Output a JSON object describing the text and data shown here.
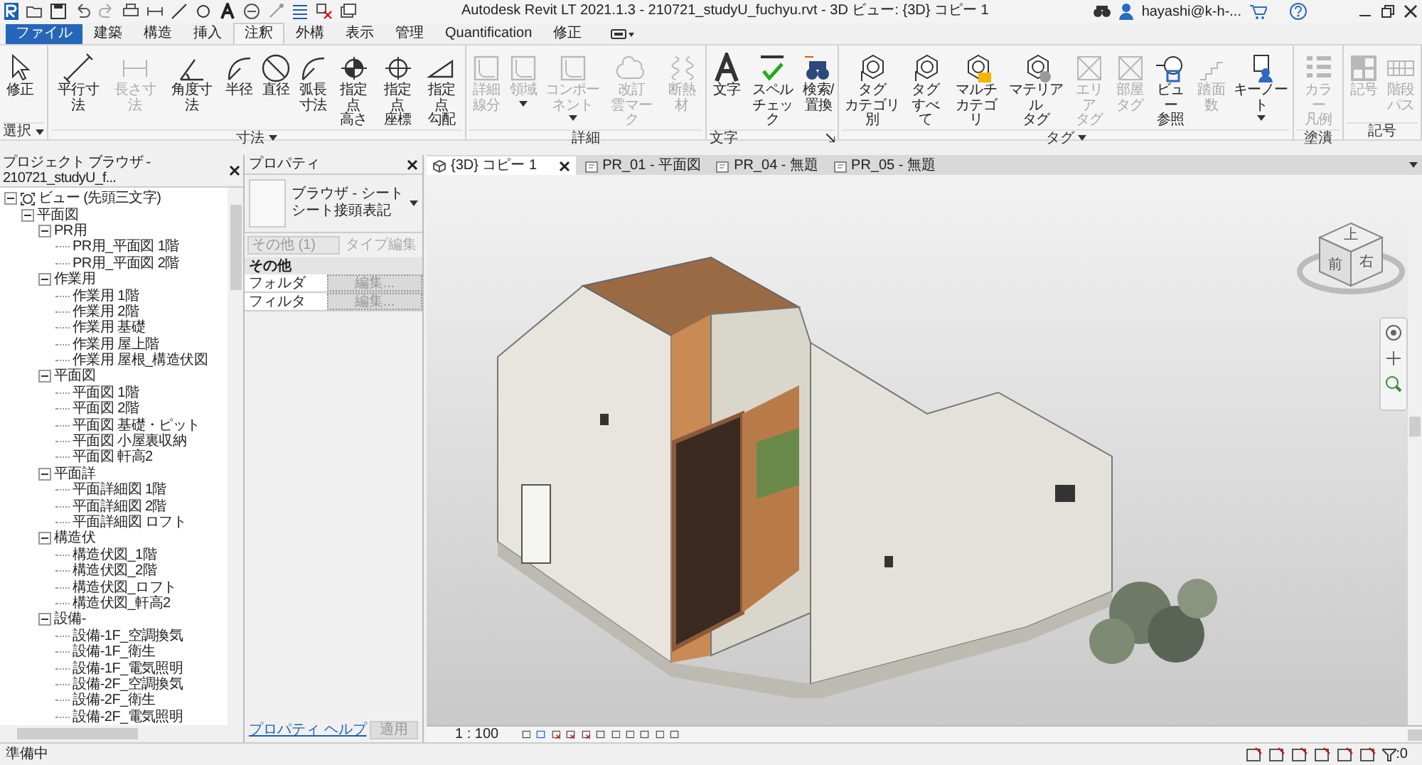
{
  "title_bar": {
    "title": "Autodesk Revit LT 2021.1.3 - 210721_studyU_fuchyu.rvt - 3D ビュー: {3D} コピー 1",
    "user": "hayashi@k-h-..."
  },
  "ribbon_tabs": [
    {
      "label": "ファイル",
      "kind": "file",
      "selected": false
    },
    {
      "label": "建築",
      "kind": "tab",
      "selected": false
    },
    {
      "label": "構造",
      "kind": "tab",
      "selected": false
    },
    {
      "label": "挿入",
      "kind": "tab",
      "selected": false
    },
    {
      "label": "注釈",
      "kind": "tab",
      "selected": true
    },
    {
      "label": "外構",
      "kind": "tab",
      "selected": false
    },
    {
      "label": "表示",
      "kind": "tab",
      "selected": false
    },
    {
      "label": "管理",
      "kind": "tab",
      "selected": false
    },
    {
      "label": "Quantification",
      "kind": "tab",
      "selected": false
    },
    {
      "label": "修正",
      "kind": "tab",
      "selected": false
    }
  ],
  "ribbon_panels": [
    {
      "title": "選択",
      "has_menu": true,
      "launcher": false,
      "tools": [
        {
          "lines": [
            "修正"
          ],
          "disabled": false,
          "dropdown": false
        }
      ]
    },
    {
      "title": "寸法",
      "has_menu": true,
      "launcher": false,
      "tools": [
        {
          "lines": [
            "平行寸法"
          ],
          "disabled": false,
          "dropdown": false
        },
        {
          "lines": [
            "長さ寸法"
          ],
          "disabled": true,
          "dropdown": false
        },
        {
          "lines": [
            "角度寸法"
          ],
          "disabled": false,
          "dropdown": false
        },
        {
          "lines": [
            "半径"
          ],
          "disabled": false,
          "dropdown": false
        },
        {
          "lines": [
            "直径"
          ],
          "disabled": false,
          "dropdown": false
        },
        {
          "lines": [
            "弧長",
            "寸法"
          ],
          "disabled": false,
          "dropdown": false
        },
        {
          "lines": [
            "指定点",
            "高さ"
          ],
          "disabled": false,
          "dropdown": false
        },
        {
          "lines": [
            "指定点",
            "座標"
          ],
          "disabled": false,
          "dropdown": false
        },
        {
          "lines": [
            "指定点",
            "勾配"
          ],
          "disabled": false,
          "dropdown": false
        }
      ]
    },
    {
      "title": "詳細",
      "has_menu": false,
      "launcher": false,
      "tools": [
        {
          "lines": [
            "詳細",
            "線分"
          ],
          "disabled": true,
          "dropdown": false
        },
        {
          "lines": [
            "領域"
          ],
          "disabled": true,
          "dropdown": true
        },
        {
          "lines": [
            "コンポーネント"
          ],
          "disabled": true,
          "dropdown": true
        },
        {
          "lines": [
            "改訂",
            "雲マーク"
          ],
          "disabled": true,
          "dropdown": false
        },
        {
          "lines": [
            "断熱材"
          ],
          "disabled": true,
          "dropdown": false
        }
      ]
    },
    {
      "title": "文字",
      "has_menu": false,
      "launcher": true,
      "tools": [
        {
          "lines": [
            "文字"
          ],
          "disabled": false,
          "dropdown": false
        },
        {
          "lines": [
            "スペル",
            "チェック"
          ],
          "disabled": false,
          "dropdown": false
        },
        {
          "lines": [
            "検索/",
            "置換"
          ],
          "disabled": false,
          "dropdown": false
        }
      ]
    },
    {
      "title": "タグ",
      "has_menu": true,
      "launcher": false,
      "tools": [
        {
          "lines": [
            "タグ",
            "カテゴリ別"
          ],
          "disabled": false,
          "dropdown": false
        },
        {
          "lines": [
            "タグ",
            "すべて"
          ],
          "disabled": false,
          "dropdown": false
        },
        {
          "lines": [
            "マルチ",
            "カテゴリ"
          ],
          "disabled": false,
          "dropdown": false
        },
        {
          "lines": [
            "マテリアル",
            "タグ"
          ],
          "disabled": false,
          "dropdown": false
        },
        {
          "lines": [
            "エリア",
            "タグ"
          ],
          "disabled": true,
          "dropdown": false
        },
        {
          "lines": [
            "部屋",
            "タグ"
          ],
          "disabled": true,
          "dropdown": false
        },
        {
          "lines": [
            "ビュー",
            "参照"
          ],
          "disabled": false,
          "dropdown": false
        },
        {
          "lines": [
            "踏面",
            "数"
          ],
          "disabled": true,
          "dropdown": false
        },
        {
          "lines": [
            "キーノート"
          ],
          "disabled": false,
          "dropdown": true
        }
      ]
    },
    {
      "title": "塗潰",
      "has_menu": false,
      "launcher": false,
      "tools": [
        {
          "lines": [
            "カラー",
            "凡例"
          ],
          "disabled": true,
          "dropdown": false
        }
      ]
    },
    {
      "title": "記号",
      "has_menu": false,
      "launcher": false,
      "tools": [
        {
          "lines": [
            "記号"
          ],
          "disabled": true,
          "dropdown": false
        },
        {
          "lines": [
            "階段",
            "パス"
          ],
          "disabled": true,
          "dropdown": false
        }
      ]
    }
  ],
  "project_browser": {
    "title": "プロジェクト ブラウザ - 210721_studyU_f...",
    "tree": [
      {
        "label": "ビュー (先頭三文字)",
        "expanded": true,
        "children": [
          {
            "label": "平面図",
            "expanded": true,
            "children": [
              {
                "label": "PR用",
                "expanded": true,
                "children": [
                  {
                    "label": "PR用_平面図 1階"
                  },
                  {
                    "label": "PR用_平面図 2階"
                  }
                ]
              },
              {
                "label": "作業用",
                "expanded": true,
                "children": [
                  {
                    "label": "作業用 1階"
                  },
                  {
                    "label": "作業用 2階"
                  },
                  {
                    "label": "作業用 基礎"
                  },
                  {
                    "label": "作業用 屋上階"
                  },
                  {
                    "label": "作業用 屋根_構造伏図"
                  }
                ]
              },
              {
                "label": "平面図",
                "expanded": true,
                "children": [
                  {
                    "label": "平面図 1階"
                  },
                  {
                    "label": "平面図 2階"
                  },
                  {
                    "label": "平面図 基礎・ピット"
                  },
                  {
                    "label": "平面図 小屋裏収納"
                  },
                  {
                    "label": "平面図 軒高2"
                  }
                ]
              },
              {
                "label": "平面詳",
                "expanded": true,
                "children": [
                  {
                    "label": "平面詳細図 1階"
                  },
                  {
                    "label": "平面詳細図 2階"
                  },
                  {
                    "label": "平面詳細図 ロフト"
                  }
                ]
              },
              {
                "label": "構造伏",
                "expanded": true,
                "children": [
                  {
                    "label": "構造伏図_1階"
                  },
                  {
                    "label": "構造伏図_2階"
                  },
                  {
                    "label": "構造伏図_ロフト"
                  },
                  {
                    "label": "構造伏図_軒高2"
                  }
                ]
              },
              {
                "label": "設備-",
                "expanded": true,
                "children": [
                  {
                    "label": "設備-1F_空調換気"
                  },
                  {
                    "label": "設備-1F_衛生"
                  },
                  {
                    "label": "設備-1F_電気照明"
                  },
                  {
                    "label": "設備-2F_空調換気"
                  },
                  {
                    "label": "設備-2F_衛生"
                  },
                  {
                    "label": "設備-2F_電気照明"
                  }
                ]
              }
            ]
          }
        ]
      }
    ]
  },
  "properties": {
    "title": "プロパティ",
    "family": "ブラウザ - シート",
    "type": "シート接頭表記",
    "instance_filter": {
      "value": "その他 (1)",
      "disabled": true
    },
    "edit_type": {
      "label": "タイプ編集",
      "disabled": true
    },
    "groups": [
      {
        "name": "その他",
        "rows": [
          {
            "label": "フォルダ",
            "value": "編集..."
          },
          {
            "label": "フィルタ",
            "value": "編集..."
          }
        ]
      }
    ],
    "help_link": "プロパティ ヘルプ",
    "apply": {
      "label": "適用",
      "disabled": true
    }
  },
  "view_tabs": [
    {
      "label": "{3D} コピー 1",
      "kind": "model",
      "selected": true
    },
    {
      "label": "PR_01 - 平面図",
      "kind": "sheet",
      "selected": false
    },
    {
      "label": "PR_04 - 無題",
      "kind": "sheet",
      "selected": false
    },
    {
      "label": "PR_05 - 無題",
      "kind": "sheet",
      "selected": false
    }
  ],
  "view_cube": {
    "faces": [
      "上",
      "前",
      "右"
    ]
  },
  "view_bar": {
    "scale": "1 : 100"
  },
  "status_bar": {
    "message": "準備中",
    "filter_count": ":0"
  }
}
